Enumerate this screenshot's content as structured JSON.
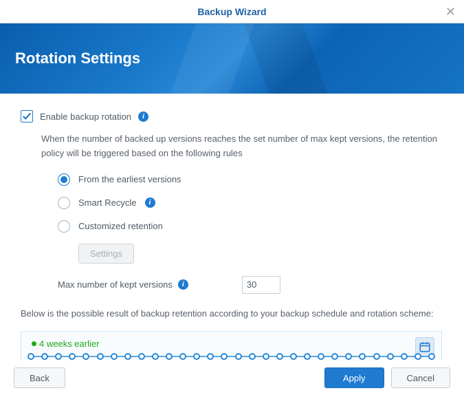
{
  "titlebar": {
    "title": "Backup Wizard"
  },
  "banner": {
    "heading": "Rotation Settings"
  },
  "enable": {
    "label": "Enable backup rotation",
    "checked": true
  },
  "description": "When the number of backed up versions reaches the set number of max kept versions, the retention policy will be triggered based on the following rules",
  "radios": {
    "earliest": "From the earliest versions",
    "smart": "Smart Recycle",
    "custom": "Customized retention",
    "selected": "earliest"
  },
  "settings_button": "Settings",
  "max_versions": {
    "label": "Max number of kept versions",
    "value": "30"
  },
  "below_text": "Below is the possible result of backup retention according to your backup schedule and rotation scheme:",
  "timeline": {
    "label": "4 weeks earlier"
  },
  "footer": {
    "back": "Back",
    "apply": "Apply",
    "cancel": "Cancel"
  }
}
